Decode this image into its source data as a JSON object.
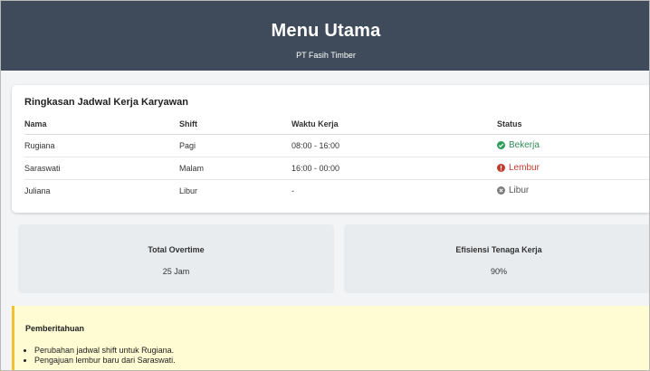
{
  "header": {
    "title": "Menu Utama",
    "subtitle": "PT Fasih Timber"
  },
  "schedule": {
    "title": "Ringkasan Jadwal Kerja Karyawan",
    "columns": [
      "Nama",
      "Shift",
      "Waktu Kerja",
      "Status"
    ],
    "rows": [
      {
        "nama": "Rugiana",
        "shift": "Pagi",
        "waktu": "08:00 - 16:00",
        "status": "Bekerja",
        "status_icon": "check-circle-icon",
        "status_color": "#2e8b57"
      },
      {
        "nama": "Saraswati",
        "shift": "Malam",
        "waktu": "16:00 - 00:00",
        "status": "Lembur",
        "status_icon": "alert-circle-icon",
        "status_color": "#c0392b"
      },
      {
        "nama": "Juliana",
        "shift": "Libur",
        "waktu": "-",
        "status": "Libur",
        "status_icon": "x-circle-icon",
        "status_color": "#7d7d7d"
      }
    ]
  },
  "metrics": [
    {
      "label": "Total Overtime",
      "value": "25 Jam"
    },
    {
      "label": "Efisiensi Tenaga Kerja",
      "value": "90%"
    }
  ],
  "notice": {
    "title": "Pemberitahuan",
    "items": [
      "Perubahan jadwal shift untuk Rugiana.",
      "Pengajuan lembur baru dari Saraswati."
    ]
  },
  "colors": {
    "header_bg": "#3f4b5a",
    "notice_bg": "#fffcd3",
    "notice_border": "#f2c230"
  }
}
